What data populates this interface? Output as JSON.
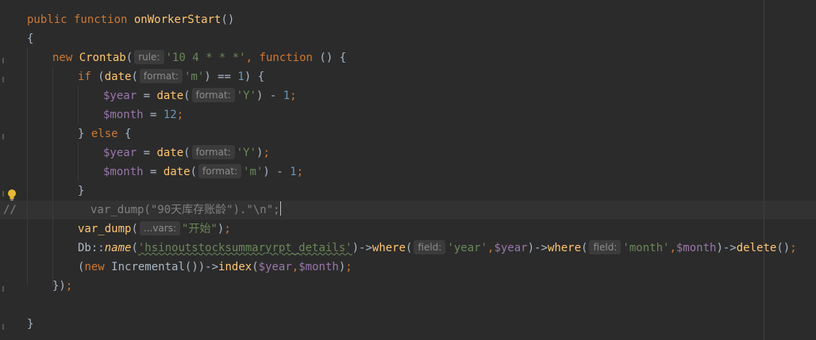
{
  "code": {
    "l1": {
      "kw": "public function",
      "name": "onWorkerStart",
      "rest": "()"
    },
    "l2": {
      "text": "{"
    },
    "l3": {
      "kw_new": "new",
      "cls": "Crontab",
      "paren": "(",
      "hint": "rule:",
      "str": "'10 4 * * *'",
      "comma": ",",
      "kw_fn": "function",
      "rest": "() {"
    },
    "l4": {
      "kw_if": "if",
      "paren1": " (",
      "fn": "date",
      "paren2": "(",
      "hint": "format:",
      "str": "'m'",
      "mid": ") == ",
      "num": "1",
      "rest": ") {"
    },
    "l5": {
      "var": "$year",
      "eq": " = ",
      "fn": "date",
      "paren": "(",
      "hint": "format:",
      "str": "'Y'",
      "mid": ") - ",
      "num": "1",
      "semi": ";"
    },
    "l6": {
      "var": "$month",
      "eq": " = ",
      "num": "12",
      "semi": ";"
    },
    "l7": {
      "brace": "}",
      "kw_else": "else",
      "rest": " {"
    },
    "l8": {
      "var": "$year",
      "eq": " = ",
      "fn": "date",
      "paren": "(",
      "hint": "format:",
      "str": "'Y'",
      "close": ")",
      "semi": ";"
    },
    "l9": {
      "var": "$month",
      "eq": " = ",
      "fn": "date",
      "paren": "(",
      "hint": "format:",
      "str": "'m'",
      "mid": ") - ",
      "num": "1",
      "semi": ";"
    },
    "l10": {
      "text": "}"
    },
    "l11": {
      "prefix": "//",
      "text": "var_dump(\"90天库存账龄\").\"\\n\";"
    },
    "l12": {
      "fn": "var_dump",
      "paren": "(",
      "hint": "...vars:",
      "str": "\"开始\"",
      "rest": ")",
      "semi": ";"
    },
    "l13": {
      "cls": "Db",
      "sep": "::",
      "static": "name",
      "p1": "(",
      "str1": "'hsinoutstocksummaryrpt_details'",
      "p2": ")->",
      "fn1": "where",
      "p3": "(",
      "hint1": "field:",
      "str2": "'year'",
      "c1": ",",
      "var1": "$year",
      "p4": ")->",
      "fn2": "where",
      "p5": "(",
      "hint2": "field:",
      "str3": "'month'",
      "c2": ",",
      "var2": "$month",
      "p6": ")->",
      "fn3": "delete",
      "p7": "()",
      "semi": ";"
    },
    "l14": {
      "p1": "(",
      "kw": "new",
      "cls": " Incremental",
      "p2": "())->",
      "fn": "index",
      "p3": "(",
      "var1": "$year",
      "c": ",",
      "var2": "$month",
      "p4": ")",
      "semi": ";"
    },
    "l15": {
      "text": "})",
      "semi": ";"
    },
    "l17": {
      "text": "}"
    }
  },
  "colors": {
    "background": "#2b2b2b",
    "keyword": "#cc7832",
    "function": "#ffc66d",
    "string": "#6a8759",
    "number": "#6897bb",
    "variable": "#9876aa"
  }
}
